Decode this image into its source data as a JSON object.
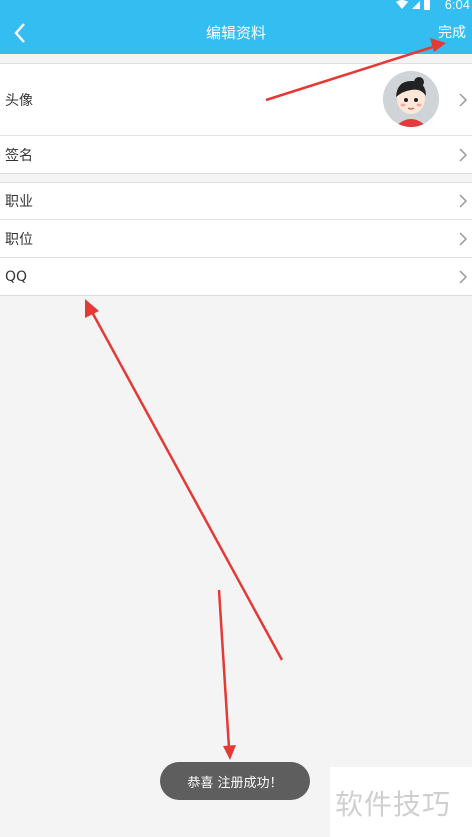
{
  "status_bar": {
    "time": "6:04"
  },
  "header": {
    "title": "编辑资料",
    "done_label": "完成",
    "back_icon": "chevron-left-icon"
  },
  "section1": {
    "avatar_label": "头像",
    "signature_label": "签名"
  },
  "section2": {
    "occupation_label": "职业",
    "position_label": "职位",
    "qq_label": "QQ"
  },
  "toast": {
    "message": "恭喜 注册成功！"
  },
  "watermark": {
    "text": "软件技巧"
  },
  "colors": {
    "header": "#33bdf1",
    "background": "#f4f4f4",
    "annotation_arrow": "#e53935",
    "toast": "#5e5e5e"
  }
}
